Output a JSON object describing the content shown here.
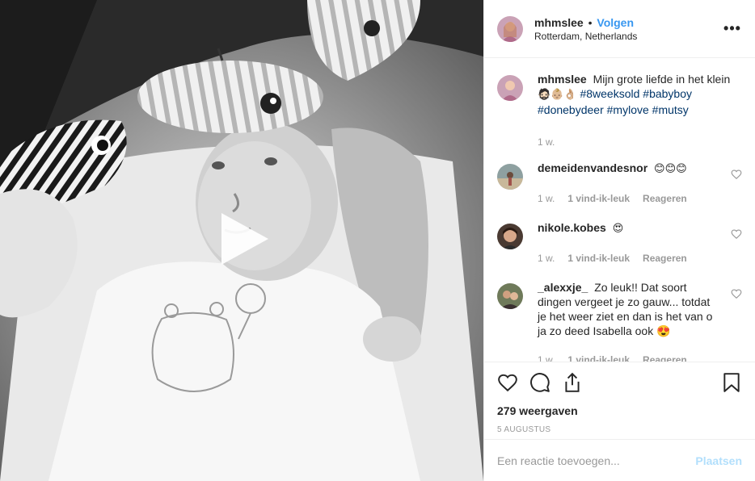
{
  "post": {
    "username": "mhmslee",
    "separator": "•",
    "follow_label": "Volgen",
    "location": "Rotterdam, Netherlands",
    "more_icon": "•••"
  },
  "caption": {
    "username": "mhmslee",
    "text": "Mijn grote liefde in het klein",
    "emojis": "🧔🏻👶🏼👌🏼",
    "tags": [
      "#8weeksold",
      "#babyboy",
      "#donebydeer",
      "#mylove",
      "#mutsy"
    ],
    "time": "1 w."
  },
  "comments": [
    {
      "username": "demeidenvandesnor",
      "text": "😊😊😊",
      "time": "1 w.",
      "likes": "1 vind-ik-leuk",
      "reply": "Reageren"
    },
    {
      "username": "nikole.kobes",
      "text": "😍",
      "time": "1 w.",
      "likes": "1 vind-ik-leuk",
      "reply": "Reageren"
    },
    {
      "username": "_alexxje_",
      "text": "Zo leuk!! Dat soort dingen vergeet je zo gauw... totdat je het weer ziet en dan is het van o ja zo deed Isabella ook 😍",
      "time": "1 w.",
      "likes": "1 vind-ik-leuk",
      "reply": "Reageren"
    }
  ],
  "stats": {
    "views": "279 weergaven",
    "date": "5 AUGUSTUS"
  },
  "add_comment": {
    "placeholder": "Een reactie toevoegen...",
    "post_label": "Plaatsen"
  },
  "colors": {
    "link": "#3897f0",
    "hashtag": "#003569",
    "muted": "#999999",
    "post_disabled": "#b2dffc"
  }
}
